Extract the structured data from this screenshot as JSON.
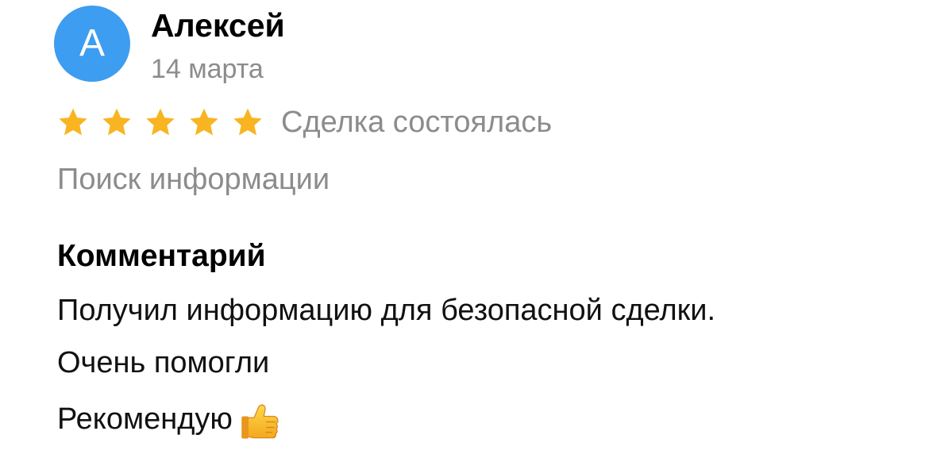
{
  "review": {
    "avatar_letter": "А",
    "author_name": "Алексей",
    "date": "14 марта",
    "rating": 5,
    "rating_max": 5,
    "deal_status": "Сделка состоялась",
    "category": "Поиск информации",
    "comment": {
      "heading": "Комментарий",
      "lines": [
        "Получил информацию для безопасной сделки.",
        "Очень помогли",
        "Рекомендую"
      ],
      "emoji": "thumbs-up-icon"
    }
  },
  "colors": {
    "avatar": "#3d9df0",
    "star": "#f8b521",
    "muted_text": "#8c8c8c",
    "text": "#111111"
  }
}
